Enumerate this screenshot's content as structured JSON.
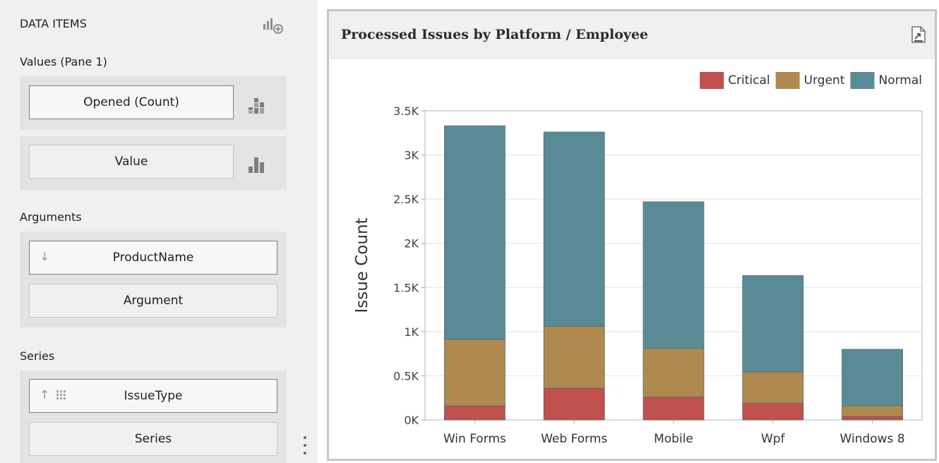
{
  "data_items_panel": {
    "title": "DATA ITEMS",
    "values_section": {
      "label": "Values (Pane 1)",
      "items": [
        {
          "label": "Opened (Count)",
          "icon": "stacked-bar-chart-icon"
        },
        {
          "label": "Value",
          "icon": "bar-chart-icon"
        }
      ]
    },
    "arguments_section": {
      "label": "Arguments",
      "items": [
        {
          "label": "ProductName",
          "sort_icon": "sort-descending-arrow-icon"
        },
        {
          "label": "Argument"
        }
      ]
    },
    "series_section": {
      "label": "Series",
      "items": [
        {
          "label": "IssueType",
          "sort_icon": "sort-ascending-arrow-icon",
          "extra_icon": "grid-icon"
        },
        {
          "label": "Series"
        }
      ]
    }
  },
  "chart_panel": {
    "title": "Processed Issues by Platform / Employee",
    "export_icon": "export-icon"
  },
  "chart_data": {
    "type": "bar",
    "stacked": true,
    "categories": [
      "Win Forms",
      "Web Forms",
      "Mobile",
      "Wpf",
      "Windows 8"
    ],
    "series": [
      {
        "name": "Critical",
        "color": "#c0504d",
        "values": [
          160,
          360,
          260,
          190,
          40
        ]
      },
      {
        "name": "Urgent",
        "color": "#b0894e",
        "values": [
          750,
          700,
          550,
          355,
          120
        ]
      },
      {
        "name": "Normal",
        "color": "#5a8a95",
        "values": [
          2420,
          2200,
          1660,
          1090,
          640
        ]
      }
    ],
    "xlabel": "",
    "ylabel": "Issue Count",
    "ylim": [
      0,
      3500
    ],
    "yticks": [
      "0K",
      "0.5K",
      "1K",
      "1.5K",
      "2K",
      "2.5K",
      "3K",
      "3.5K"
    ],
    "legend_position": "top-right",
    "grid": true
  }
}
